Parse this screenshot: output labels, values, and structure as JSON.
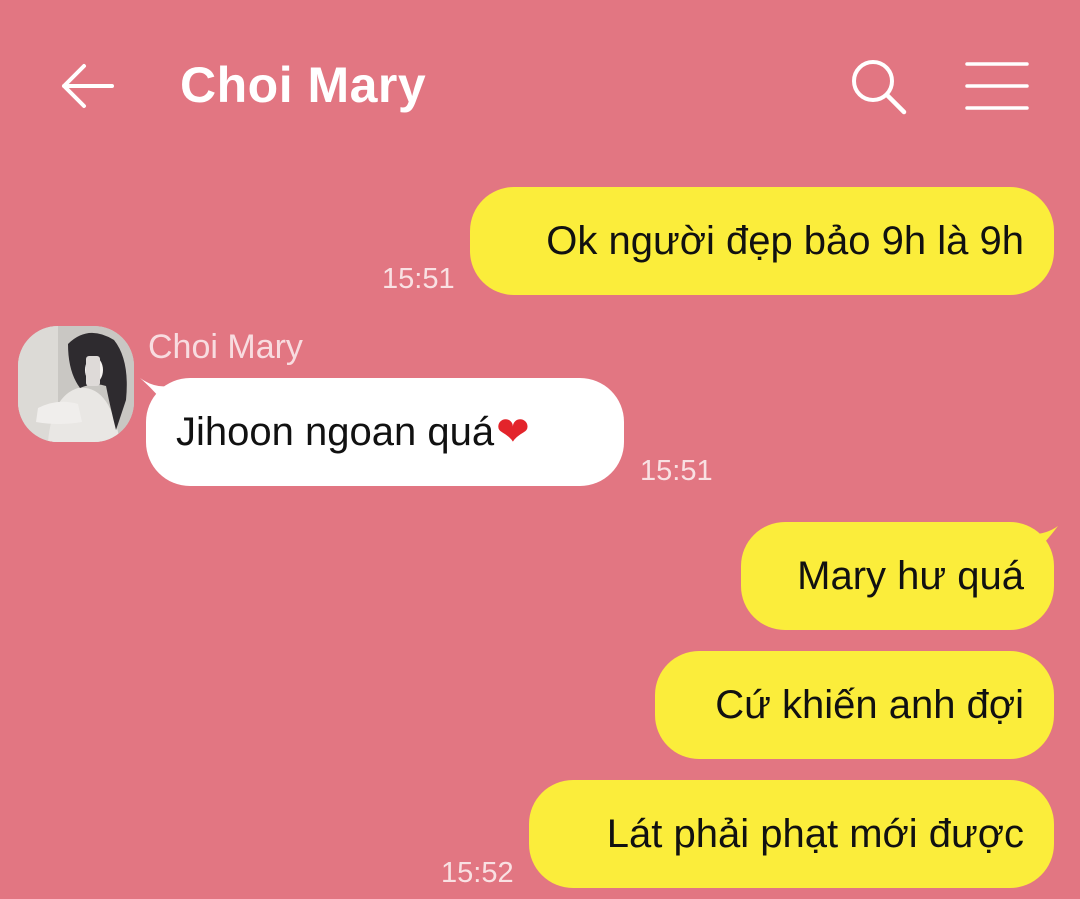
{
  "header": {
    "title": "Choi Mary",
    "back_icon": "arrow-left-icon",
    "search_icon": "search-icon",
    "menu_icon": "hamburger-menu-icon"
  },
  "colors": {
    "background": "#e27682",
    "outgoing_bubble": "#fbed3b",
    "incoming_bubble": "#ffffff"
  },
  "messages": [
    {
      "direction": "outgoing",
      "text": "Ok người đẹp bảo 9h là 9h",
      "time": "15:51"
    },
    {
      "direction": "incoming",
      "sender": "Choi Mary",
      "text": "Jihoon ngoan quá",
      "emoji": "❤",
      "time": "15:51"
    },
    {
      "direction": "outgoing",
      "text": "Mary hư quá"
    },
    {
      "direction": "outgoing",
      "text": "Cứ khiến anh đợi"
    },
    {
      "direction": "outgoing",
      "text": "Lát phải phạt mới được",
      "time": "15:52"
    }
  ]
}
